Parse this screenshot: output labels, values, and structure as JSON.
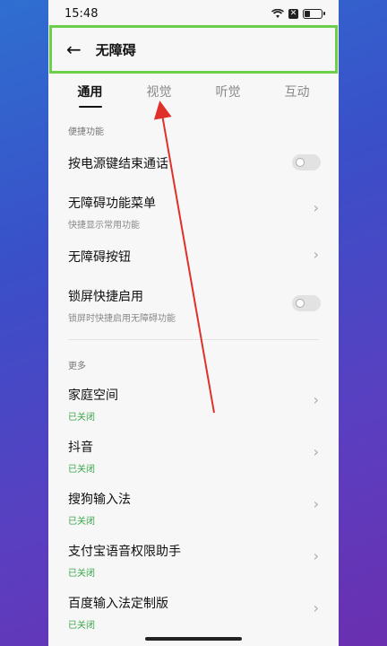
{
  "status_bar": {
    "time": "15:48"
  },
  "header": {
    "back_icon": "arrow-left-icon",
    "title": "无障碍"
  },
  "tabs": [
    {
      "label": "通用",
      "active": true
    },
    {
      "label": "视觉",
      "active": false
    },
    {
      "label": "听觉",
      "active": false
    },
    {
      "label": "互动",
      "active": false
    }
  ],
  "sections": {
    "shortcuts_label": "便捷功能",
    "more_label": "更多"
  },
  "shortcut_items": [
    {
      "title": "按电源键结束通话",
      "control": "toggle",
      "on": false
    },
    {
      "title": "无障碍功能菜单",
      "subtitle": "快捷显示常用功能",
      "control": "chevron"
    },
    {
      "title": "无障碍按钮",
      "control": "chevron"
    },
    {
      "title": "锁屏快捷启用",
      "subtitle": "锁屏时快捷启用无障碍功能",
      "control": "toggle",
      "on": false
    }
  ],
  "more_items": [
    {
      "title": "家庭空间",
      "subtitle": "已关闭"
    },
    {
      "title": "抖音",
      "subtitle": "已关闭"
    },
    {
      "title": "搜狗输入法",
      "subtitle": "已关闭"
    },
    {
      "title": "支付宝语音权限助手",
      "subtitle": "已关闭"
    },
    {
      "title": "百度输入法定制版",
      "subtitle": "已关闭"
    }
  ],
  "colors": {
    "highlight_border": "#6ccf4a",
    "status_green": "#3aa54a",
    "annotation_arrow": "#e0302a"
  }
}
